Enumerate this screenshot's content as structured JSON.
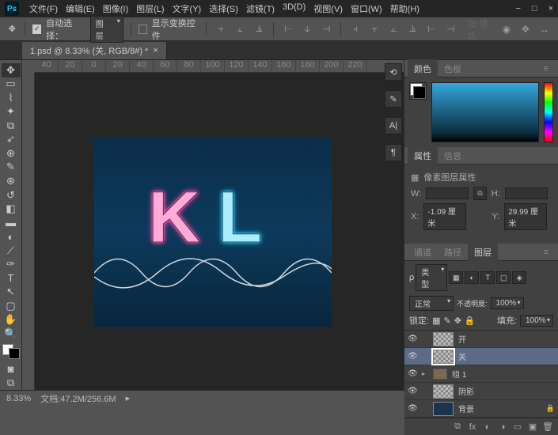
{
  "menu": [
    "文件(F)",
    "编辑(E)",
    "图像(I)",
    "图层(L)",
    "文字(Y)",
    "选择(S)",
    "滤镜(T)",
    "3D(D)",
    "视图(V)",
    "窗口(W)",
    "帮助(H)"
  ],
  "options": {
    "auto_select_label": "自动选择：",
    "auto_select_value": "图层",
    "show_transform_label": "显示变换控件"
  },
  "tab": {
    "title": "1.psd @ 8.33% (关, RGB/8#) *"
  },
  "ruler_marks": [
    "40",
    "20",
    "0",
    "20",
    "40",
    "60",
    "80",
    "100",
    "120",
    "140",
    "160",
    "180",
    "200",
    "220"
  ],
  "canvas": {
    "k": "K",
    "l": "L"
  },
  "color_tabs": {
    "color": "颜色",
    "swatches": "色板"
  },
  "props": {
    "tab1": "属性",
    "tab2": "信息",
    "title": "像素图层属性",
    "w_label": "W:",
    "h_label": "H:",
    "x_label": "X:",
    "x_value": "-1.09 厘米",
    "y_label": "Y:",
    "y_value": "29.99 厘米"
  },
  "layers": {
    "tabs": [
      "通道",
      "路径",
      "图层"
    ],
    "kind_label": "类型",
    "blend_mode": "正常",
    "opacity_label": "不透明度:",
    "opacity_value": "100%",
    "lock_label": "锁定:",
    "fill_label": "填充:",
    "fill_value": "100%",
    "items": [
      {
        "name": "开",
        "thumb": "checker",
        "selected": false
      },
      {
        "name": "关",
        "thumb": "checker",
        "selected": true
      },
      {
        "name": "组 1",
        "thumb": "folder"
      },
      {
        "name": "阴影",
        "thumb": "checker"
      },
      {
        "name": "背景",
        "thumb": "solid"
      }
    ]
  },
  "status": {
    "zoom": "8.33%",
    "doc": "文档:47.2M/256.6M"
  }
}
